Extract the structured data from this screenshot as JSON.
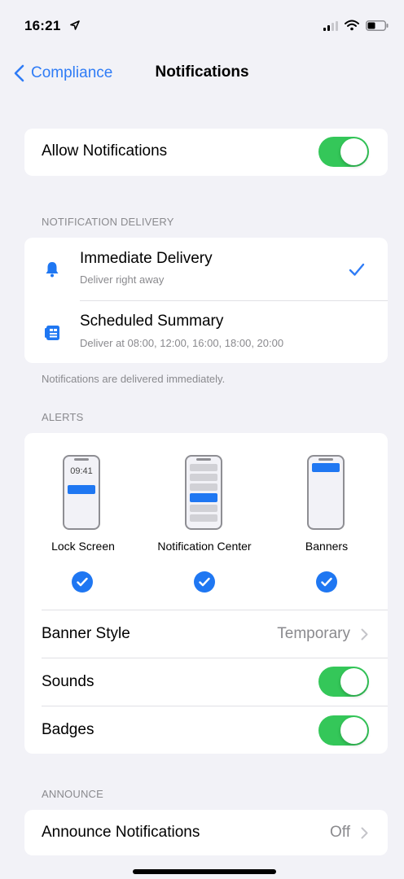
{
  "status_bar": {
    "time": "16:21",
    "icons": [
      "location-arrow-icon",
      "signal-icon",
      "wifi-icon",
      "battery-icon"
    ]
  },
  "nav": {
    "back_label": "Compliance",
    "title": "Notifications"
  },
  "allow": {
    "label": "Allow Notifications",
    "on": true
  },
  "delivery": {
    "header": "NOTIFICATION DELIVERY",
    "options": [
      {
        "title": "Immediate Delivery",
        "subtitle": "Deliver right away",
        "icon": "bell-icon",
        "selected": true
      },
      {
        "title": "Scheduled Summary",
        "subtitle": "Deliver at 08:00, 12:00, 16:00, 18:00, 20:00",
        "icon": "summary-icon",
        "selected": false
      }
    ],
    "footer": "Notifications are delivered immediately."
  },
  "alerts": {
    "header": "ALERTS",
    "lock_screen_time": "09:41",
    "styles": [
      {
        "label": "Lock Screen",
        "checked": true
      },
      {
        "label": "Notification Center",
        "checked": true
      },
      {
        "label": "Banners",
        "checked": true
      }
    ],
    "banner_style": {
      "label": "Banner Style",
      "value": "Temporary"
    },
    "sounds": {
      "label": "Sounds",
      "on": true
    },
    "badges": {
      "label": "Badges",
      "on": true
    }
  },
  "announce": {
    "header": "ANNOUNCE",
    "label": "Announce Notifications",
    "value": "Off"
  },
  "colors": {
    "accent": "#2f7cf6",
    "toggle_on": "#34c759",
    "background": "#f2f2f7"
  }
}
